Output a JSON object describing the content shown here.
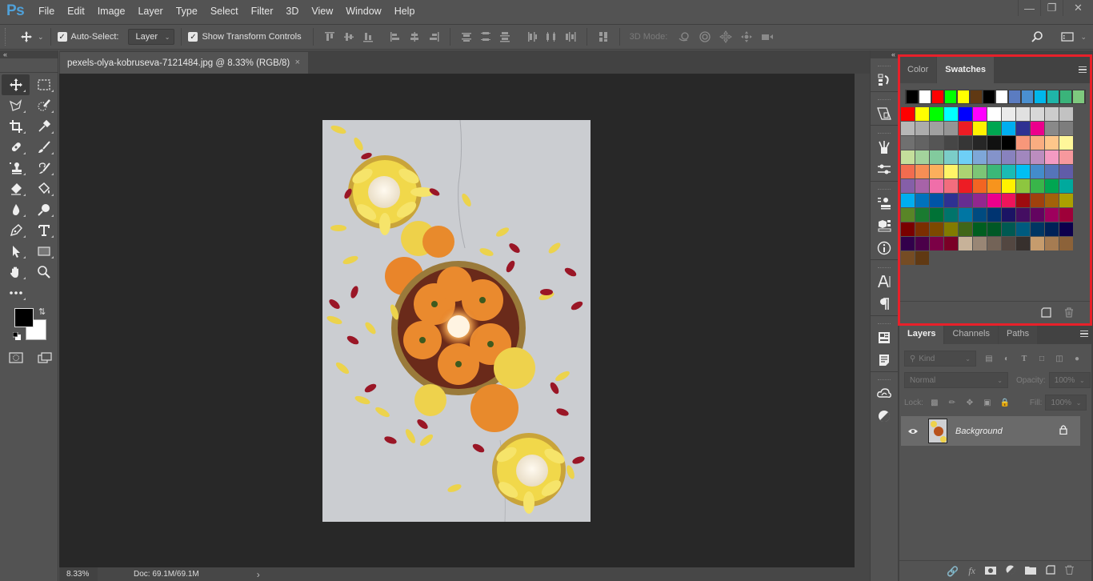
{
  "app": {
    "logo": "Ps",
    "name": "Adobe Photoshop"
  },
  "menu": [
    "File",
    "Edit",
    "Image",
    "Layer",
    "Type",
    "Select",
    "Filter",
    "3D",
    "View",
    "Window",
    "Help"
  ],
  "window_controls": {
    "minimize": "minimize-icon",
    "restore": "restore-icon",
    "close": "close-icon"
  },
  "options_bar": {
    "tool_icon": "move-tool-icon",
    "auto_select_checked": true,
    "auto_select_label": "Auto-Select:",
    "auto_select_value": "Layer",
    "show_transform_checked": true,
    "show_transform_label": "Show Transform Controls",
    "mode_3d_label": "3D Mode:",
    "align_icons": [
      "align-top-edges",
      "align-vertical-centers",
      "align-bottom-edges",
      "align-left-edges",
      "align-horizontal-centers",
      "align-right-edges",
      "distribute-top",
      "distribute-vertical-centers",
      "distribute-bottom",
      "distribute-left",
      "distribute-horizontal-centers",
      "distribute-right",
      "auto-align-layers"
    ],
    "mode_3d_icons": [
      "orbit-3d",
      "roll-3d",
      "pan-3d",
      "slide-3d",
      "scale-3d"
    ],
    "search_icon": "search-icon",
    "workspace_icon": "workspace-icon"
  },
  "toolbar": {
    "tools": [
      {
        "name": "move-tool",
        "active": true
      },
      {
        "name": "rectangular-marquee-tool"
      },
      {
        "name": "lasso-tool"
      },
      {
        "name": "quick-selection-tool"
      },
      {
        "name": "crop-tool"
      },
      {
        "name": "eyedropper-tool"
      },
      {
        "name": "spot-healing-brush-tool"
      },
      {
        "name": "brush-tool"
      },
      {
        "name": "clone-stamp-tool"
      },
      {
        "name": "history-brush-tool"
      },
      {
        "name": "eraser-tool"
      },
      {
        "name": "paint-bucket-tool"
      },
      {
        "name": "blur-tool"
      },
      {
        "name": "dodge-tool"
      },
      {
        "name": "pen-tool"
      },
      {
        "name": "type-tool"
      },
      {
        "name": "path-selection-tool"
      },
      {
        "name": "rectangle-tool"
      },
      {
        "name": "hand-tool"
      },
      {
        "name": "zoom-tool"
      },
      {
        "name": "edit-toolbar"
      }
    ],
    "foreground_color": "#000000",
    "background_color": "#ffffff"
  },
  "document": {
    "tab_title": "pexels-olya-kobruseva-7121484.jpg @ 8.33% (RGB/8)",
    "close_glyph": "×",
    "zoom": "8.33%",
    "doc_info": "Doc: 69.1M/69.1M",
    "status_arrow": "›"
  },
  "dock": {
    "groups": [
      [
        "history-icon"
      ],
      [
        "artboard-icon"
      ],
      [
        "brush-presets-icon",
        "adjustments-icon"
      ],
      [
        "clone-source-icon",
        "3d-icon",
        "info-icon"
      ],
      [
        "character-icon",
        "paragraph-icon"
      ],
      [
        "properties-icon",
        "notes-icon"
      ],
      [
        "libraries-icon",
        "styles-icon"
      ]
    ]
  },
  "swatches_panel": {
    "tabs": [
      {
        "label": "Color",
        "active": false
      },
      {
        "label": "Swatches",
        "active": true
      }
    ],
    "recent": [
      "#000000",
      "#ffffff",
      "#ff0000",
      "#00ff00",
      "#ffff00",
      "#603913",
      "#000000",
      "#ffffff",
      "#5b7cc1",
      "#4a90d0",
      "#00b7eb",
      "#1fb5a8",
      "#3ab37a",
      "#7ec97e"
    ],
    "grid": [
      "#ff0000",
      "#ffff00",
      "#00ff00",
      "#00ffff",
      "#0000ff",
      "#ff00ff",
      "#ffffff",
      "#ebebeb",
      "#e1e1e1",
      "#d7d7d7",
      "#cccccc",
      "#c2c2c2",
      "#b7b7b7",
      "#acacac",
      "#a0a0a0",
      "#959595",
      "#ed1c24",
      "#fff200",
      "#00a651",
      "#00aeef",
      "#2e3192",
      "#ec008c",
      "#898989",
      "#7d7d7d",
      "#707070",
      "#636363",
      "#555555",
      "#464646",
      "#363636",
      "#262626",
      "#111111",
      "#000000",
      "#f7977a",
      "#f9ad81",
      "#fdc68a",
      "#fff79a",
      "#c4df9b",
      "#a3d39c",
      "#82ca9d",
      "#7bcdc8",
      "#6ecff6",
      "#7ea7d8",
      "#8493ca",
      "#8882be",
      "#a187be",
      "#bc8dbf",
      "#f49ac2",
      "#f6989d",
      "#f26c4f",
      "#f68e55",
      "#fbaf5c",
      "#fff467",
      "#acd372",
      "#7cc576",
      "#3bb878",
      "#1abbb4",
      "#00bff3",
      "#438ccb",
      "#5574b9",
      "#605ca8",
      "#855fa8",
      "#a763a8",
      "#f06ea9",
      "#f26d7d",
      "#ed1c24",
      "#f26522",
      "#f7941d",
      "#fff200",
      "#8dc63f",
      "#39b54a",
      "#00a651",
      "#00a99d",
      "#00aeef",
      "#0072bc",
      "#0054a6",
      "#2e3192",
      "#662d91",
      "#92278f",
      "#ec008c",
      "#ed145b",
      "#9e0b0f",
      "#a0410d",
      "#a3620a",
      "#aba000",
      "#598527",
      "#1a7b30",
      "#007236",
      "#00746b",
      "#0076a3",
      "#004b80",
      "#003471",
      "#1b1464",
      "#440e62",
      "#630460",
      "#9e005d",
      "#9e0039",
      "#790000",
      "#7b2e00",
      "#7d4900",
      "#827b00",
      "#406618",
      "#005e20",
      "#005826",
      "#005952",
      "#005b7f",
      "#003663",
      "#002157",
      "#0d004c",
      "#32004b",
      "#4b0049",
      "#7b0046",
      "#7a0026",
      "#c7b299",
      "#998675",
      "#736357",
      "#534741",
      "#37302d",
      "#c69c6d",
      "#a67c52",
      "#8c6239",
      "#754c24",
      "#603913"
    ],
    "footer_icons": [
      "new-swatch-icon",
      "delete-swatch-icon"
    ],
    "highlight_color": "#e8202a"
  },
  "layers_panel": {
    "tabs": [
      {
        "label": "Layers",
        "active": true
      },
      {
        "label": "Channels",
        "active": false
      },
      {
        "label": "Paths",
        "active": false
      }
    ],
    "filter_placeholder": "Kind",
    "blend_mode": "Normal",
    "opacity_label": "Opacity:",
    "opacity_value": "100%",
    "lock_label": "Lock:",
    "fill_label": "Fill:",
    "fill_value": "100%",
    "layers": [
      {
        "name": "Background",
        "visible": true,
        "locked": true
      }
    ],
    "footer_icons": [
      "link-layers-icon",
      "fx-icon",
      "add-mask-icon",
      "adjustment-layer-icon",
      "new-group-icon",
      "new-layer-icon",
      "delete-layer-icon"
    ]
  }
}
